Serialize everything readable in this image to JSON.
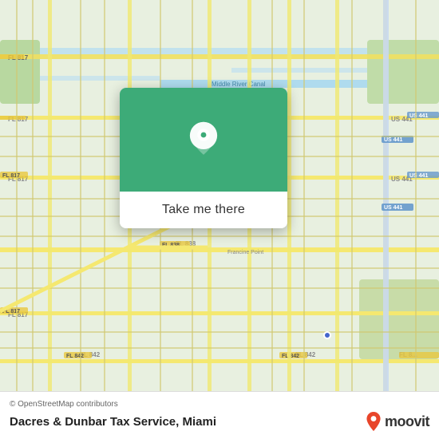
{
  "map": {
    "attribution": "© OpenStreetMap contributors",
    "background_color": "#e8efe8"
  },
  "card": {
    "button_label": "Take me there",
    "pin_color": "#4caf88"
  },
  "bottom_bar": {
    "attribution": "© OpenStreetMap contributors",
    "place_name": "Dacres & Dunbar Tax Service, Miami",
    "moovit_label": "moovit"
  }
}
